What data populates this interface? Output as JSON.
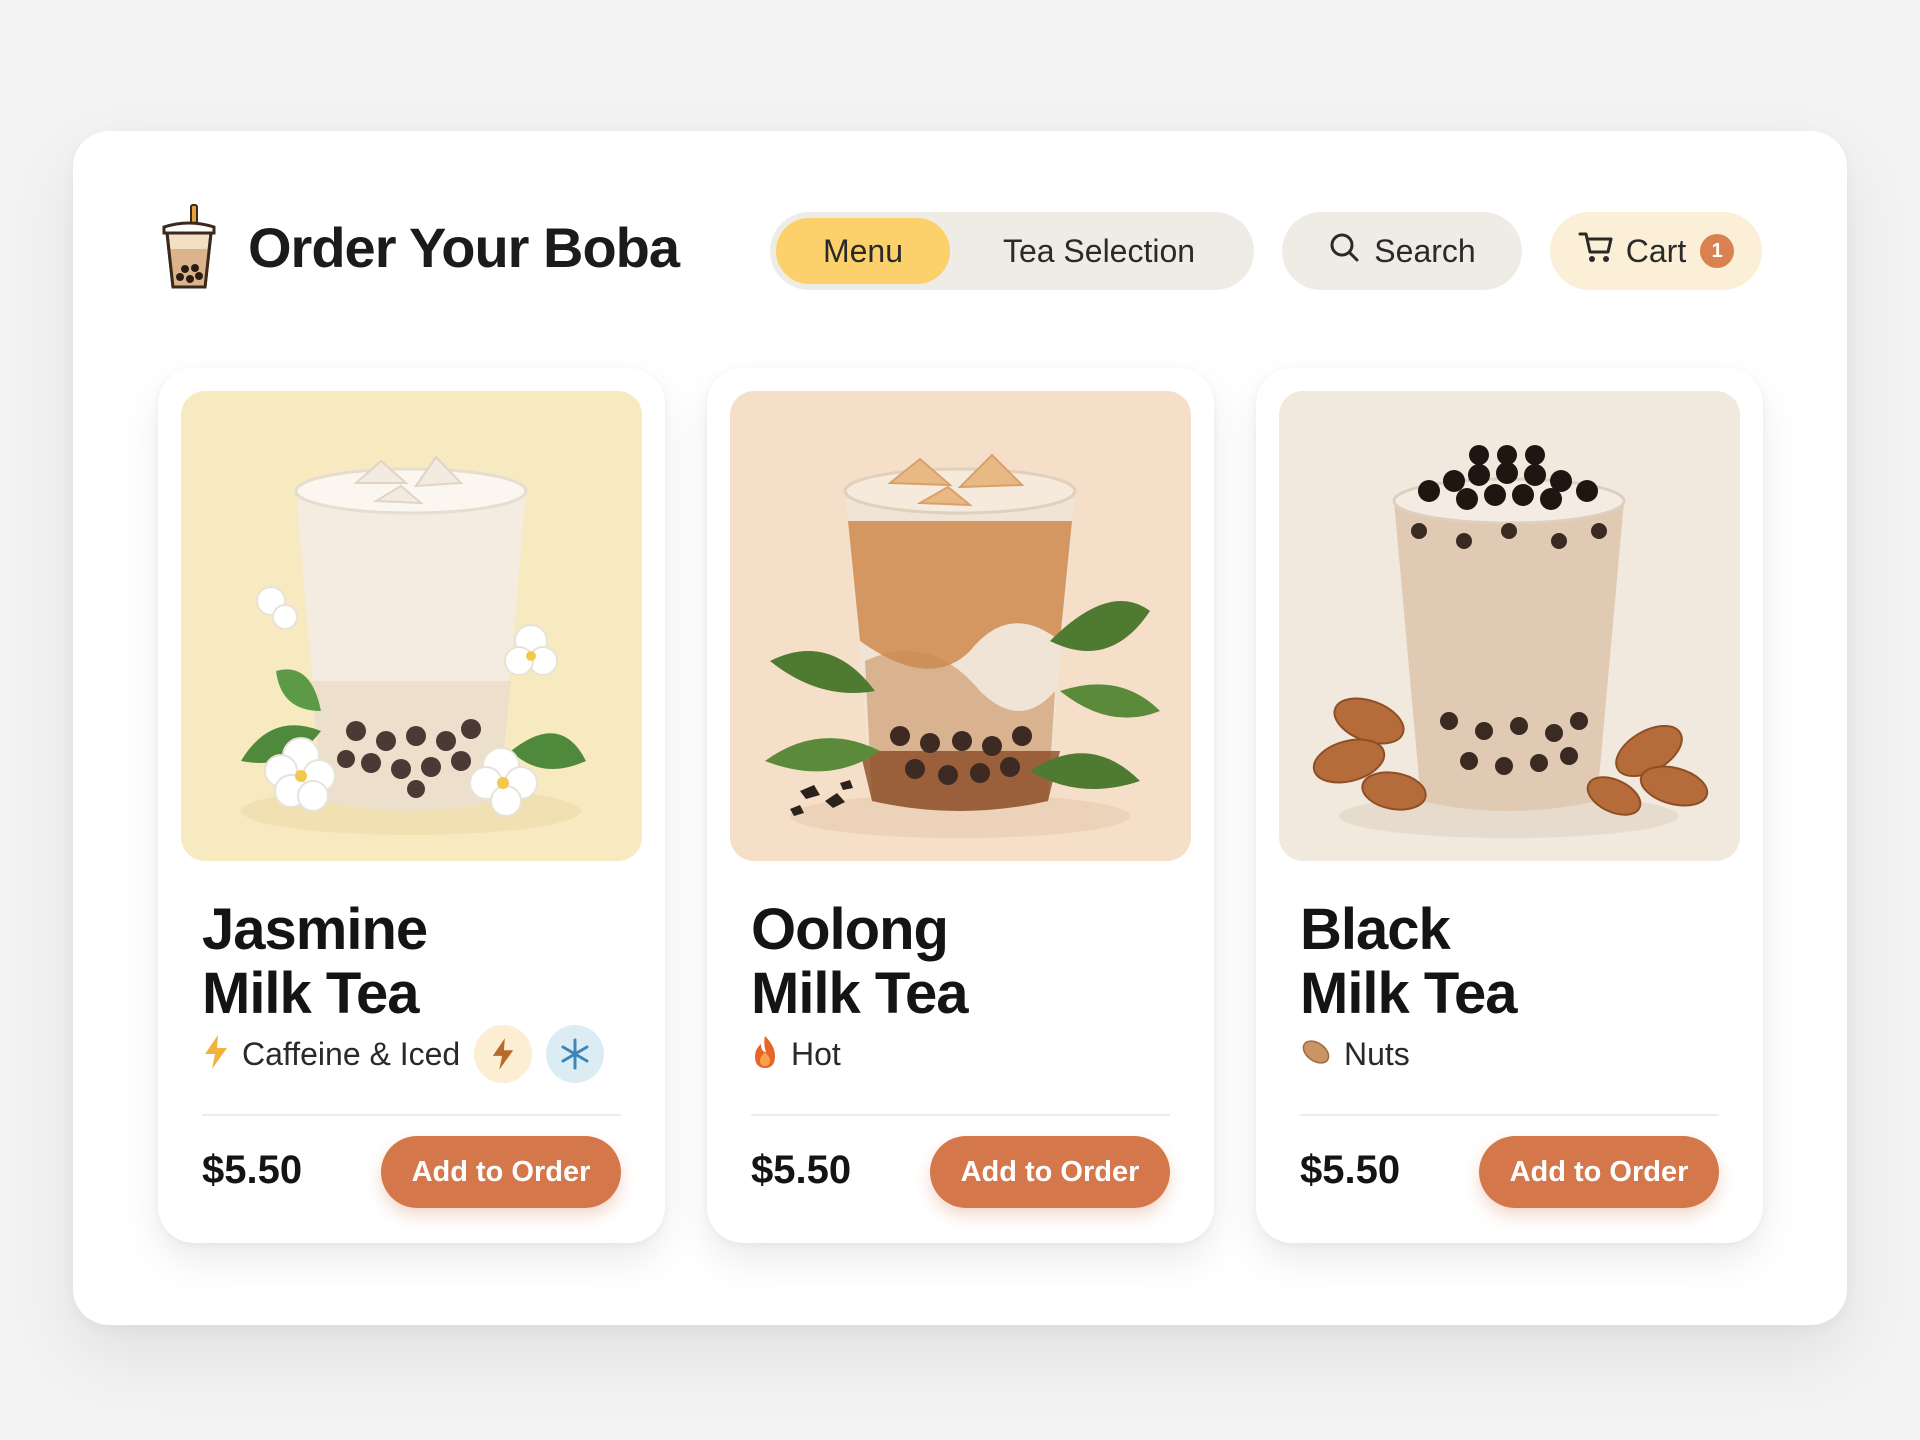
{
  "header": {
    "title": "Order Your Boba",
    "nav": [
      {
        "label": "Menu",
        "active": true
      },
      {
        "label": "Tea Selection",
        "active": false
      }
    ],
    "search_label": "Search",
    "cart_label": "Cart",
    "cart_count": "1"
  },
  "colors": {
    "accent_yellow": "#fcd06a",
    "button_orange": "#d4784c",
    "pill_gray": "#efece6",
    "cart_bg": "#fcefd7"
  },
  "products": [
    {
      "name_line1": "Jasmine",
      "name_line2": "Milk Tea",
      "tag_icon": "lightning-icon",
      "tag": "Caffeine & Iced",
      "extra_icons": [
        "lightning-icon",
        "snowflake-icon"
      ],
      "price": "$5.50",
      "button": "Add to Order",
      "image": "jasmine-milk-tea-image"
    },
    {
      "name_line1": "Oolong",
      "name_line2": "Milk Tea",
      "tag_icon": "flame-icon",
      "tag": "Hot",
      "price": "$5.50",
      "button": "Add to Order",
      "image": "oolong-milk-tea-image"
    },
    {
      "name_line1": "Black",
      "name_line2": "Milk Tea",
      "tag_icon": "almond-icon",
      "tag": "Nuts",
      "price": "$5.50",
      "button": "Add to Order",
      "image": "black-milk-tea-image"
    }
  ]
}
